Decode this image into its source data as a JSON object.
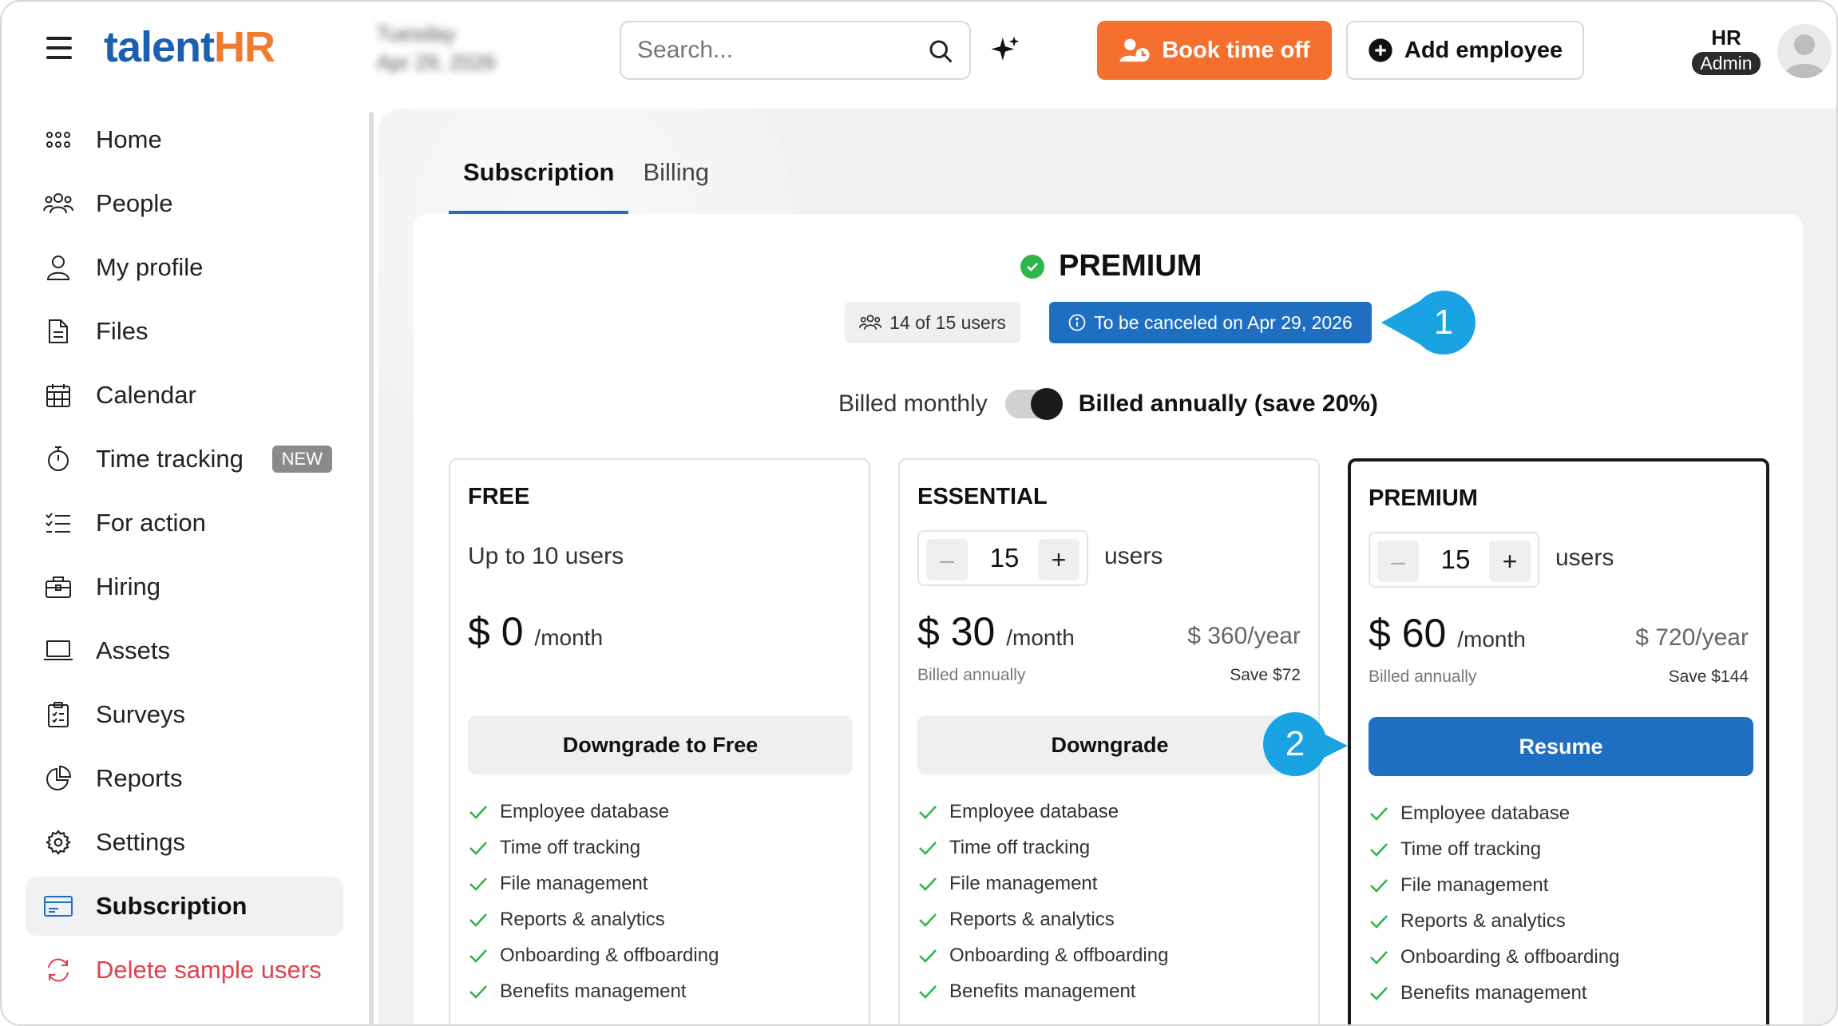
{
  "header": {
    "logo_part1": "talent",
    "logo_part2": "HR",
    "date_line1": "Tuesday",
    "date_line2": "Apr 29, 2026",
    "search_placeholder": "Search...",
    "book_time_off_label": "Book time off",
    "add_employee_label": "Add employee",
    "user_role_top": "HR",
    "user_role_badge": "Admin"
  },
  "sidebar": {
    "items": [
      {
        "label": "Home",
        "icon": "grid-icon"
      },
      {
        "label": "People",
        "icon": "people-icon"
      },
      {
        "label": "My profile",
        "icon": "user-icon"
      },
      {
        "label": "Files",
        "icon": "file-icon"
      },
      {
        "label": "Calendar",
        "icon": "calendar-icon"
      },
      {
        "label": "Time tracking",
        "icon": "stopwatch-icon",
        "badge": "NEW"
      },
      {
        "label": "For action",
        "icon": "checklist-icon"
      },
      {
        "label": "Hiring",
        "icon": "briefcase-icon"
      },
      {
        "label": "Assets",
        "icon": "laptop-icon"
      },
      {
        "label": "Surveys",
        "icon": "clipboard-icon"
      },
      {
        "label": "Reports",
        "icon": "pie-chart-icon"
      },
      {
        "label": "Settings",
        "icon": "gear-icon"
      },
      {
        "label": "Subscription",
        "icon": "credit-card-icon",
        "active": true
      },
      {
        "label": "Delete sample users",
        "icon": "refresh-icon",
        "danger": true
      }
    ]
  },
  "tabs": [
    {
      "label": "Subscription",
      "active": true
    },
    {
      "label": "Billing",
      "active": false
    }
  ],
  "current_plan": {
    "name": "PREMIUM",
    "users_pill": "14 of 15 users",
    "cancel_pill": "To be canceled on Apr 29, 2026"
  },
  "callouts": {
    "one": "1",
    "two": "2"
  },
  "billing_toggle": {
    "monthly_label": "Billed monthly",
    "annual_label": "Billed annually (save 20%)",
    "annual_selected": true
  },
  "plans": {
    "free": {
      "name": "FREE",
      "subtitle": "Up to 10 users",
      "price": "$ 0",
      "per": "/month",
      "button": "Downgrade to Free",
      "features": [
        "Employee database",
        "Time off tracking",
        "File management",
        "Reports & analytics",
        "Onboarding & offboarding",
        "Benefits management"
      ]
    },
    "essential": {
      "name": "ESSENTIAL",
      "users_value": "15",
      "users_label": "users",
      "price": "$ 30",
      "per": "/month",
      "yearly": "$ 360/year",
      "billed": "Billed annually",
      "save": "Save $72",
      "button": "Downgrade",
      "features": [
        "Employee database",
        "Time off tracking",
        "File management",
        "Reports & analytics",
        "Onboarding & offboarding",
        "Benefits management"
      ]
    },
    "premium": {
      "name": "PREMIUM",
      "users_value": "15",
      "users_label": "users",
      "price": "$ 60",
      "per": "/month",
      "yearly": "$ 720/year",
      "billed": "Billed annually",
      "save": "Save $144",
      "button": "Resume",
      "features": [
        "Employee database",
        "Time off tracking",
        "File management",
        "Reports & analytics",
        "Onboarding & offboarding",
        "Benefits management"
      ]
    }
  },
  "colors": {
    "brand_blue": "#1e6fc2",
    "brand_orange": "#f5702f",
    "callout_blue": "#1aa3e3",
    "check_green": "#2fb64b",
    "danger_red": "#e0404f"
  }
}
